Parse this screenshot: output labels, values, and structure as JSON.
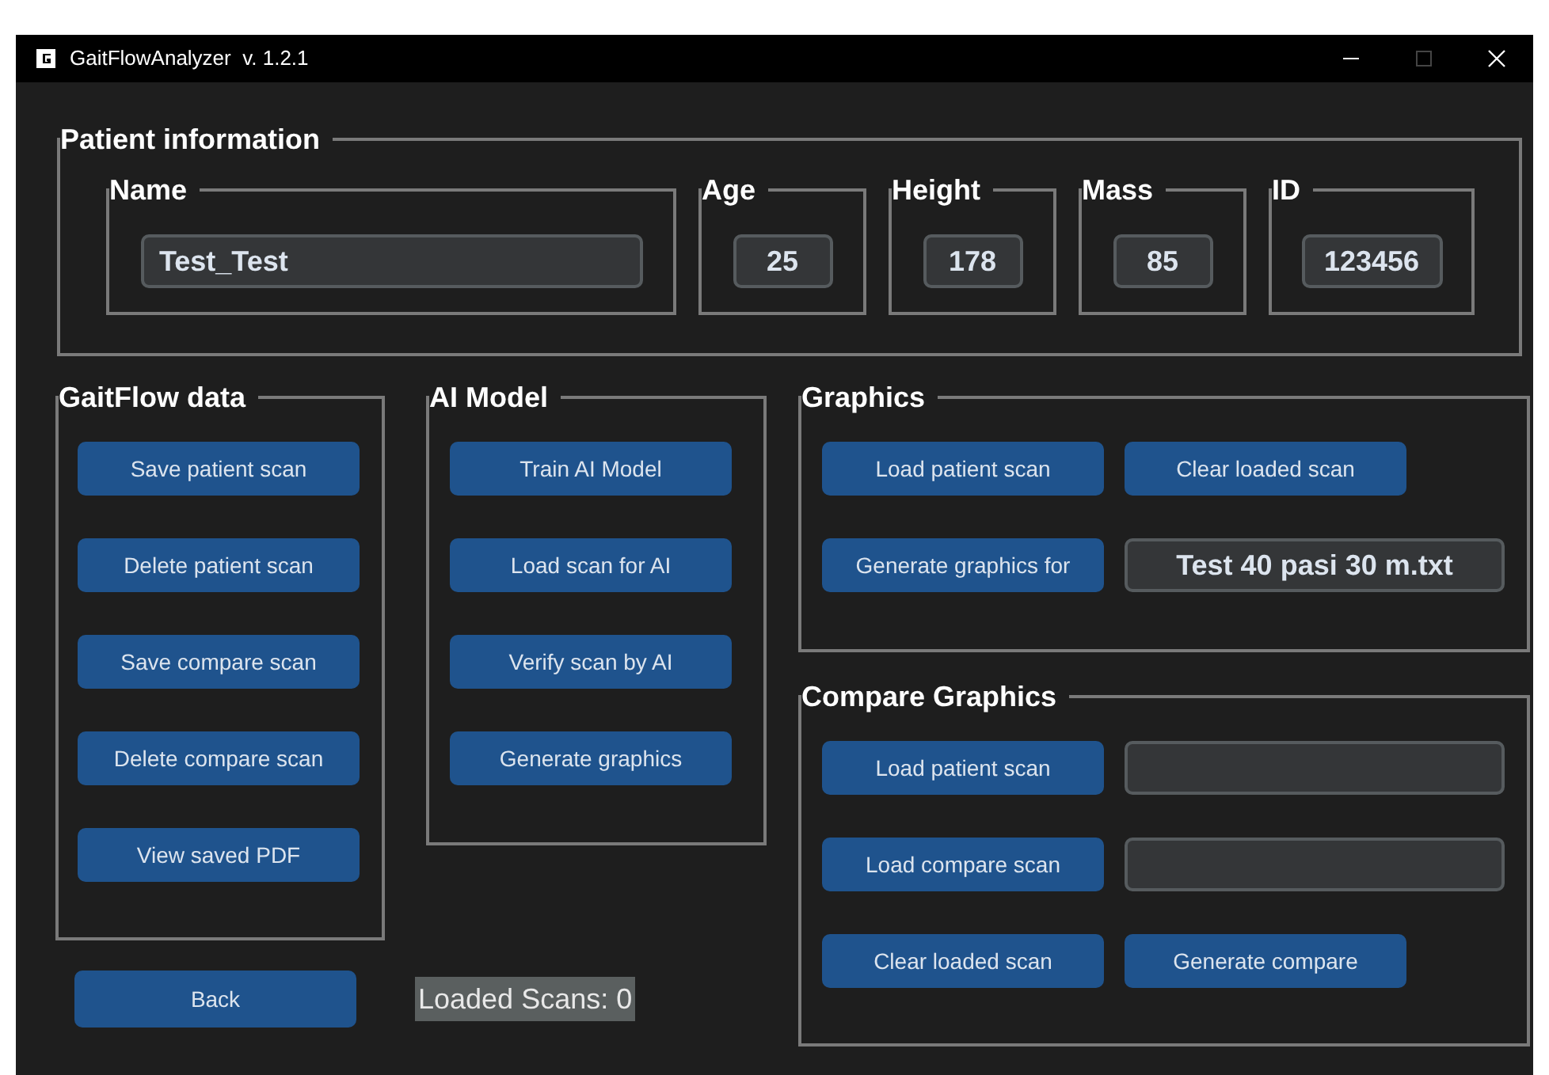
{
  "window": {
    "title": "GaitFlowAnalyzer  v. 1.2.1"
  },
  "patient_information": {
    "title": "Patient information",
    "fields": [
      {
        "label": "Name",
        "value": "Test_Test",
        "kind": "wide"
      },
      {
        "label": "Age",
        "value": "25",
        "kind": "small"
      },
      {
        "label": "Height",
        "value": "178",
        "kind": "small"
      },
      {
        "label": "Mass",
        "value": "85",
        "kind": "small"
      },
      {
        "label": "ID",
        "value": "123456",
        "kind": "medium"
      }
    ]
  },
  "gaitflow_data": {
    "title": "GaitFlow data",
    "buttons": [
      "Save patient scan",
      "Delete patient scan",
      "Save compare scan",
      "Delete compare scan",
      "View saved PDF"
    ]
  },
  "ai_model": {
    "title": "AI Model",
    "buttons": [
      "Train AI Model",
      "Load scan for AI",
      "Verify scan by AI",
      "Generate graphics"
    ]
  },
  "graphics": {
    "title": "Graphics",
    "cells": [
      {
        "kind": "button",
        "label": "Load patient scan"
      },
      {
        "kind": "button",
        "label": "Clear loaded scan"
      },
      {
        "kind": "button",
        "label": "Generate graphics for"
      },
      {
        "kind": "field",
        "value": "Test 40 pasi 30 m.txt"
      }
    ]
  },
  "compare_graphics": {
    "title": "Compare Graphics",
    "cells": [
      {
        "kind": "button",
        "label": "Load patient scan"
      },
      {
        "kind": "field"
      },
      {
        "kind": "button",
        "label": "Load compare scan"
      },
      {
        "kind": "field"
      },
      {
        "kind": "button",
        "label": "Clear loaded scan"
      },
      {
        "kind": "button",
        "label": "Generate compare"
      }
    ]
  },
  "back_button": "Back",
  "loaded_scans": "Loaded Scans: 0"
}
